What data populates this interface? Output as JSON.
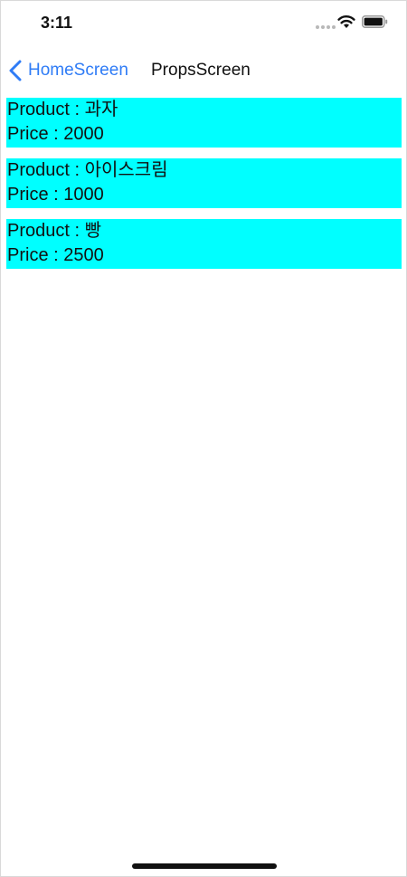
{
  "status_bar": {
    "time": "3:11"
  },
  "nav": {
    "back_label": "HomeScreen",
    "title": "PropsScreen"
  },
  "products": [
    {
      "product_line": "Product : 과자",
      "price_line": "Price : 2000"
    },
    {
      "product_line": "Product : 아이스크림",
      "price_line": "Price : 1000"
    },
    {
      "product_line": "Product : 빵",
      "price_line": "Price : 2500"
    }
  ],
  "colors": {
    "card_background": "#00ffff",
    "accent": "#2f7cf6"
  }
}
